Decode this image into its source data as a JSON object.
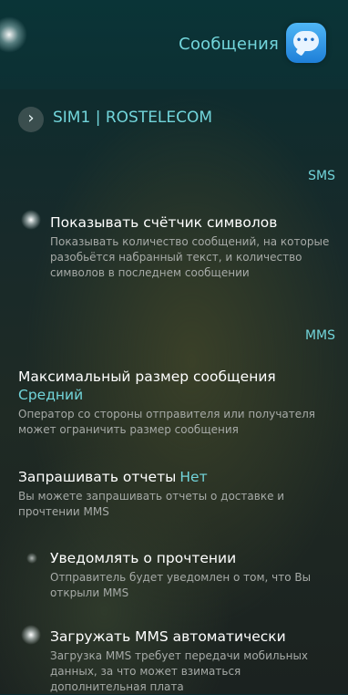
{
  "header": {
    "title": "Сообщения",
    "app_icon": "messages-app-icon",
    "app_icon_colors": [
      "#4fb6f5",
      "#1e7fd8"
    ]
  },
  "sim": {
    "label": "SIM1 | ROSTELECOM",
    "icon": "chevron-right-icon"
  },
  "sections": {
    "sms": "SMS",
    "mms": "MMS"
  },
  "settings": {
    "char_counter": {
      "title": "Показывать счётчик символов",
      "description": "Показывать количество сообщений, на которые разобьётся набранный текст, и количество символов в последнем сообщении",
      "enabled": true
    },
    "max_size": {
      "title": "Максимальный размер сообщения",
      "value": "Средний",
      "description": "Оператор со стороны отправителя или получателя может ограничить размер сообщения"
    },
    "reports": {
      "title": "Запрашивать отчеты",
      "value": "Нет",
      "description": "Вы можете запрашивать отчеты о доставке и прочтении MMS"
    },
    "read_notify": {
      "title": "Уведомлять о прочтении",
      "description": "Отправитель будет уведомлен о том, что Вы открыли MMS",
      "enabled": false
    },
    "auto_mms": {
      "title": "Загружать MMS автоматически",
      "description": "Загрузка MMS требует передачи мобильных данных, за что может взиматься дополнительная плата",
      "enabled": true
    }
  },
  "colors": {
    "accent": "#72d5db",
    "text": "#ffffff",
    "secondary_text": "#a6aaa7",
    "header_bg": "#0a3437"
  }
}
